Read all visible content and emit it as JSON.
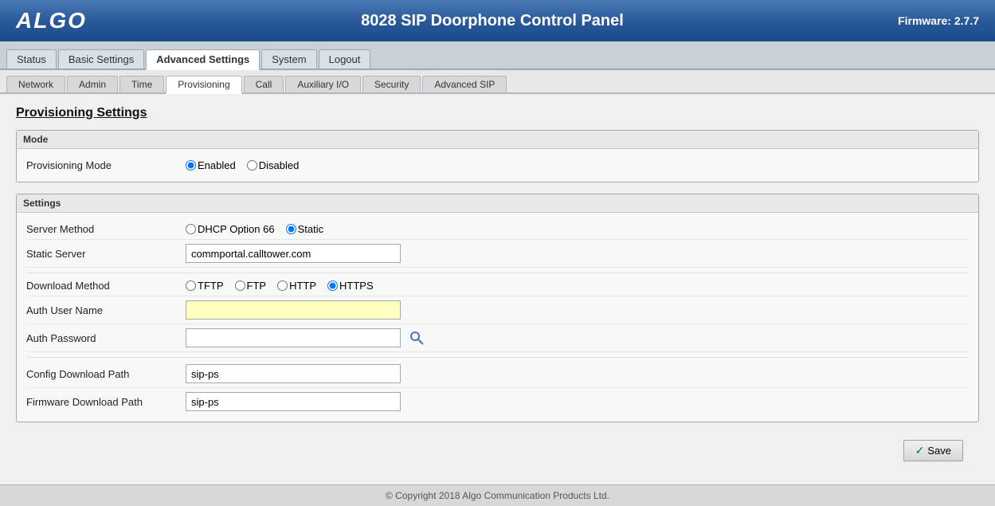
{
  "header": {
    "logo": "ALGO",
    "title": "8028 SIP Doorphone Control Panel",
    "firmware": "Firmware: 2.7.7"
  },
  "top_nav": {
    "tabs": [
      {
        "id": "status",
        "label": "Status",
        "active": false
      },
      {
        "id": "basic-settings",
        "label": "Basic Settings",
        "active": false
      },
      {
        "id": "advanced-settings",
        "label": "Advanced Settings",
        "active": true
      },
      {
        "id": "system",
        "label": "System",
        "active": false
      },
      {
        "id": "logout",
        "label": "Logout",
        "active": false
      }
    ]
  },
  "sub_nav": {
    "tabs": [
      {
        "id": "network",
        "label": "Network",
        "active": false
      },
      {
        "id": "admin",
        "label": "Admin",
        "active": false
      },
      {
        "id": "time",
        "label": "Time",
        "active": false
      },
      {
        "id": "provisioning",
        "label": "Provisioning",
        "active": true
      },
      {
        "id": "call",
        "label": "Call",
        "active": false
      },
      {
        "id": "auxiliary-io",
        "label": "Auxiliary I/O",
        "active": false
      },
      {
        "id": "security",
        "label": "Security",
        "active": false
      },
      {
        "id": "advanced-sip",
        "label": "Advanced SIP",
        "active": false
      }
    ]
  },
  "page": {
    "title": "Provisioning Settings",
    "mode_section": {
      "legend": "Mode",
      "provisioning_mode_label": "Provisioning Mode",
      "enabled_label": "Enabled",
      "disabled_label": "Disabled",
      "mode_value": "enabled"
    },
    "settings_section": {
      "legend": "Settings",
      "server_method_label": "Server Method",
      "dhcp_label": "DHCP Option 66",
      "static_label": "Static",
      "server_method_value": "static",
      "static_server_label": "Static Server",
      "static_server_value": "commportal.calltower.com",
      "download_method_label": "Download Method",
      "tftp_label": "TFTP",
      "ftp_label": "FTP",
      "http_label": "HTTP",
      "https_label": "HTTPS",
      "download_method_value": "https",
      "auth_username_label": "Auth User Name",
      "auth_username_value": "",
      "auth_password_label": "Auth Password",
      "auth_password_value": "",
      "config_download_label": "Config Download Path",
      "config_download_value": "sip-ps",
      "firmware_download_label": "Firmware Download Path",
      "firmware_download_value": "sip-ps"
    },
    "save_button_label": "Save"
  },
  "footer": {
    "copyright": "© Copyright 2018 Algo Communication Products Ltd."
  }
}
